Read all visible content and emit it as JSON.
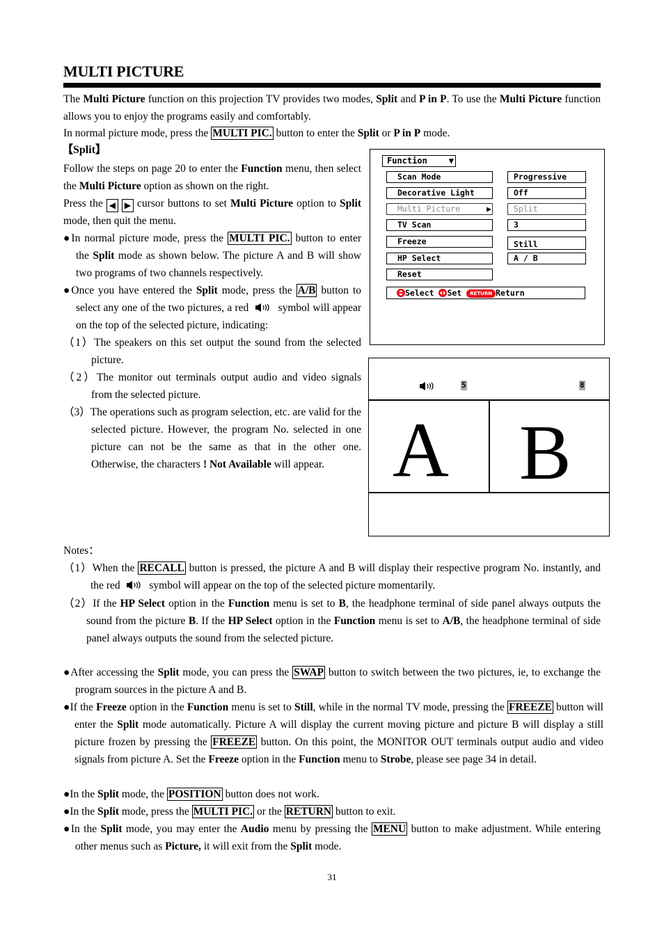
{
  "section_title": "MULTI PICTURE",
  "intro": {
    "p1_parts": [
      "The ",
      "Multi Picture",
      " function on this projection TV provides two modes, ",
      "Split",
      " and ",
      "P in P",
      ". To use the ",
      "Multi Picture",
      " function allows you to enjoy the programs easily and comfortably."
    ],
    "p2_parts": [
      "In normal picture mode, press the ",
      "MULTI PIC.",
      " button to enter the ",
      "Split",
      " or ",
      "P in P",
      " mode."
    ]
  },
  "split_heading": "【Split】",
  "split_left": {
    "p1_parts": [
      "Follow the steps on page 20 to enter the ",
      "Function",
      " menu, then select the ",
      "Multi Picture",
      " option as shown on the right."
    ],
    "p2_parts": [
      "Press the ",
      " cursor buttons to set ",
      "Multi Picture",
      " option to ",
      "Split",
      " mode, then quit the menu."
    ],
    "left_arrow": "◀",
    "right_arrow": "▶",
    "bullet1_parts": [
      "●",
      "In normal picture mode, press the ",
      "MULTI PIC.",
      " button to enter the ",
      "Split",
      " mode as shown below. The picture A and B will show two programs of two channels respectively."
    ],
    "bullet2_parts": [
      "●",
      "Once you have entered the ",
      "Split",
      " mode, press the ",
      "A/B",
      " button to select any one of the two pictures, a red ",
      " symbol will appear on the top of the selected picture, indicating:"
    ],
    "items": [
      {
        "num": "（1）",
        "parts": [
          "The speakers on this set output the sound from the selected picture."
        ]
      },
      {
        "num": "（2）",
        "parts": [
          "The monitor out terminals output audio and video signals from the selected picture."
        ]
      },
      {
        "num": "（3）",
        "parts": [
          "The operations such as program selection, etc. are valid for the selected picture. However, the program No. selected in one picture can not be the same as that in the other one. Otherwise, the characters ",
          "! Not Available",
          " will appear."
        ]
      }
    ]
  },
  "function_menu": {
    "title": "Function",
    "title_icon": "▼",
    "items": [
      {
        "label": "Scan Mode",
        "value": "Progressive",
        "highlighted": false
      },
      {
        "label": "Decorative Light",
        "value": "Off",
        "highlighted": false
      },
      {
        "label": "Multi Picture",
        "value": "Split",
        "highlighted": true,
        "arrow": "▶"
      },
      {
        "label": "TV Scan",
        "value": "3",
        "highlighted": false
      },
      {
        "label": "Freeze",
        "value": "Still",
        "highlighted": false
      },
      {
        "label": "HP Select",
        "value": "A / B",
        "highlighted": false
      },
      {
        "label": "Reset",
        "value": null,
        "highlighted": false
      }
    ],
    "footer": {
      "select_label": "Select",
      "set_label": "Set",
      "return_pill": "RETURN",
      "return_label": "Return"
    },
    "accent_color": "#e8101a",
    "disabled_color": "#8a8a8a"
  },
  "split_screen": {
    "picture_a_label": "A",
    "picture_b_label": "B",
    "program_a": "5",
    "program_b": "8",
    "selected_picture": "A",
    "speaker_icon": "speaker-icon"
  },
  "notes": {
    "heading": "Notes：",
    "n1_parts": [
      "（1）",
      "When the ",
      "RECALL",
      " button is pressed, the picture A and B will display their respective program No. instantly, and the red ",
      " symbol will appear on the top of the selected picture momentarily."
    ],
    "n2_parts": [
      "（2）",
      "If the ",
      "HP Select",
      " option in the ",
      "Function",
      " menu is set to ",
      "B",
      ", the headphone terminal of side panel always outputs the sound from the picture ",
      "B",
      ". If the ",
      "HP Select",
      " option in the ",
      "Function",
      " menu is set to ",
      "A/B",
      ", the headphone terminal of side panel always outputs the sound from the selected picture."
    ]
  },
  "bullets": {
    "b1_parts": [
      "●",
      "After accessing the ",
      "Split",
      " mode, you can press the ",
      "SWAP",
      " button to switch between the two pictures, ie, to exchange the program sources in the picture A and B."
    ],
    "b2_parts": [
      "●",
      "If the ",
      "Freeze",
      " option in the ",
      "Function",
      " menu is set to ",
      "Still",
      ", while in the normal TV mode, pressing the ",
      "FREEZE",
      " button will enter the ",
      "Split",
      " mode automatically. Picture A will display the current moving picture and picture B will display a still picture frozen by pressing the ",
      "FREEZE",
      " button. On this point, the MONITOR OUT terminals output audio and video signals from picture A. Set the ",
      "Freeze",
      " option in the ",
      "Function",
      " menu to ",
      "Strobe",
      ", please see page 34 in detail."
    ],
    "b3_parts": [
      "●",
      "In the ",
      "Split",
      " mode, the ",
      "POSITION",
      " button does not work."
    ],
    "b4_parts": [
      "●",
      "In the ",
      "Split",
      " mode, press the ",
      "MULTI PIC.",
      " or the ",
      "RETURN",
      " button to exit."
    ],
    "b5_parts": [
      "●",
      "In the ",
      "Split",
      " mode, you may enter the ",
      "Audio",
      " menu by pressing the ",
      "MENU",
      " button to make adjustment. While entering other menus such as ",
      "Picture,",
      " it will exit from the ",
      "Split",
      " mode."
    ]
  },
  "page_number": "31"
}
